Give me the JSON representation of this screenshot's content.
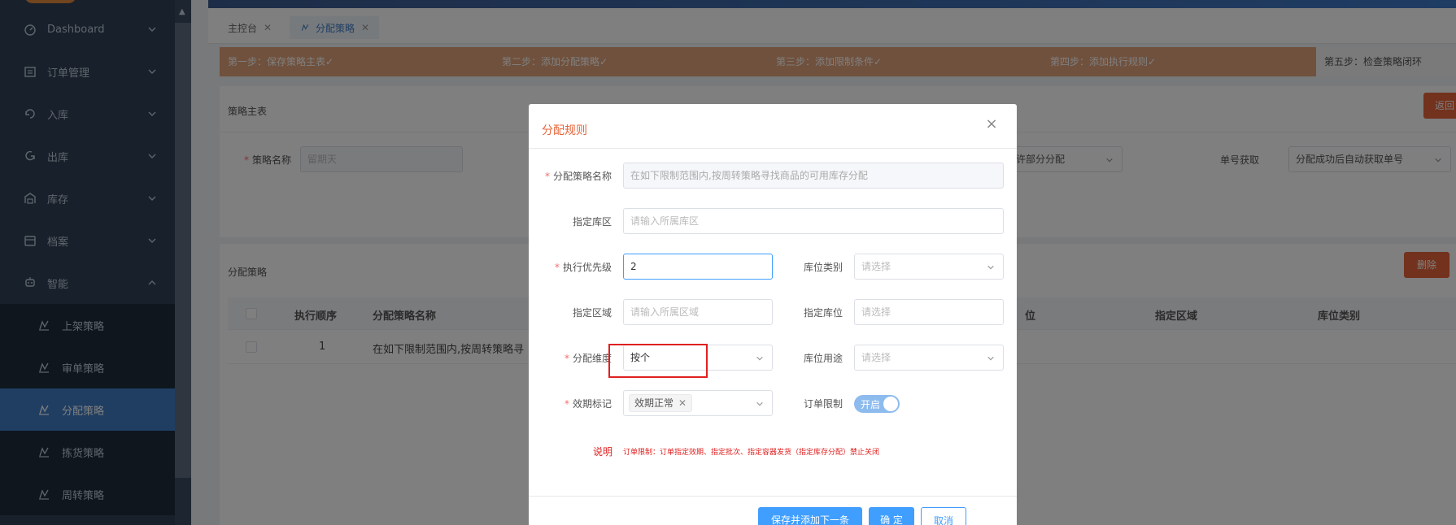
{
  "sidebar": {
    "items": [
      {
        "label": "Dashboard",
        "icon": "dashboard-icon"
      },
      {
        "label": "订单管理",
        "icon": "order-icon"
      },
      {
        "label": "入库",
        "icon": "inbound-icon"
      },
      {
        "label": "出库",
        "icon": "outbound-icon"
      },
      {
        "label": "库存",
        "icon": "inventory-icon"
      },
      {
        "label": "档案",
        "icon": "archive-icon"
      },
      {
        "label": "智能",
        "icon": "smart-icon"
      }
    ],
    "sub_items": [
      {
        "label": "上架策略"
      },
      {
        "label": "审单策略"
      },
      {
        "label": "分配策略"
      },
      {
        "label": "拣货策略"
      },
      {
        "label": "周转策略"
      }
    ]
  },
  "tabs": [
    {
      "label": "主控台"
    },
    {
      "label": "分配策略"
    }
  ],
  "steps": [
    "第一步：保存策略主表✓",
    "第二步：添加分配策略✓",
    "第三步：添加限制条件✓",
    "第四步：添加执行规则✓",
    "第五步：检查策略闭环"
  ],
  "strategy_card": {
    "title": "策略主表",
    "back_label": "返回",
    "name_label": "策略名称",
    "name_value": "留期天",
    "middle_select_value": "许部分分配",
    "order_label": "单号获取",
    "order_value": "分配成功后自动获取单号"
  },
  "alloc_card": {
    "title": "分配策略",
    "delete_label": "删除",
    "columns": [
      "执行顺序",
      "分配策略名称",
      "位",
      "指定区域",
      "库位类别"
    ],
    "rows": [
      {
        "order": "1",
        "name": "在如下限制范围内,按周转策略寻"
      }
    ]
  },
  "dialog": {
    "title": "分配规则",
    "close_glyph": "×",
    "rule_name_label": "分配策略名称",
    "rule_name_placeholder": "在如下限制范围内,按周转策略寻找商品的可用库存分配",
    "zone_label": "指定库区",
    "zone_placeholder": "请输入所属库区",
    "priority_label": "执行优先级",
    "priority_value": "2",
    "loc_type_label": "库位类别",
    "loc_type_placeholder": "请选择",
    "area_label": "指定区域",
    "area_placeholder": "请输入所属区域",
    "loc_label": "指定库位",
    "loc_placeholder": "请选择",
    "dimension_label": "分配维度",
    "dimension_value": "按个",
    "loc_use_label": "库位用途",
    "loc_use_placeholder": "请选择",
    "expiry_label": "效期标记",
    "expiry_tag": "效期正常",
    "order_limit_label": "订单限制",
    "toggle_text": "开启",
    "toggle_on": true,
    "note_label": "说明",
    "note_text": "订单限制：订单指定效期、指定批次、指定容器发货（指定库存分配）禁止关闭",
    "save_next_label": "保存并添加下一条",
    "confirm_label": "确 定",
    "cancel_label": "取消"
  },
  "colors": {
    "sidebar_bg": "#304156",
    "active_blue": "#3f7cc4",
    "step_orange": "#e0a37a",
    "danger": "#e5643a",
    "primary": "#409eff",
    "highlight_red": "#e02020"
  }
}
